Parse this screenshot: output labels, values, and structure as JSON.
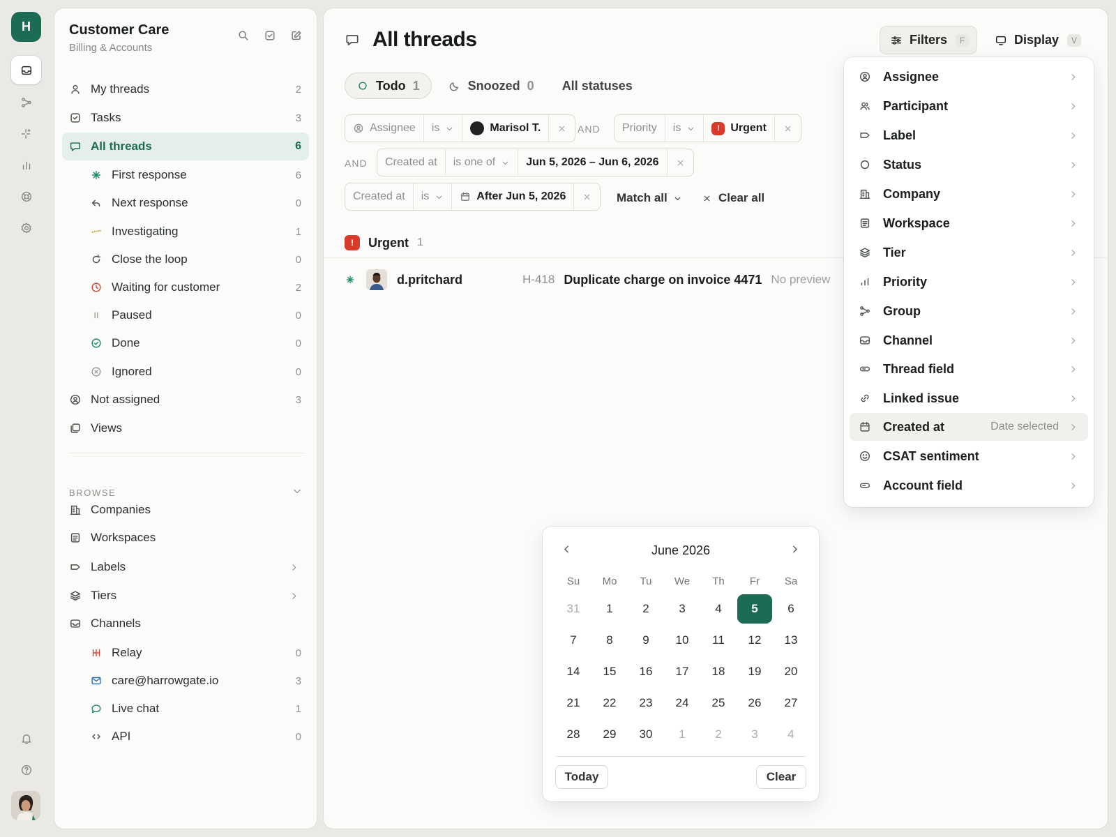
{
  "workspace": {
    "initial": "H"
  },
  "sidebar": {
    "title": "Customer Care",
    "subtitle": "Billing & Accounts",
    "items": [
      {
        "label": "My threads",
        "count": "2"
      },
      {
        "label": "Tasks",
        "count": "3"
      },
      {
        "label": "All threads",
        "count": "6"
      },
      {
        "label": "First response",
        "count": "6"
      },
      {
        "label": "Next response",
        "count": "0"
      },
      {
        "label": "Investigating",
        "count": "1"
      },
      {
        "label": "Close the loop",
        "count": "0"
      },
      {
        "label": "Waiting for customer",
        "count": "2"
      },
      {
        "label": "Paused",
        "count": "0"
      },
      {
        "label": "Done",
        "count": "0"
      },
      {
        "label": "Ignored",
        "count": "0"
      },
      {
        "label": "Not assigned",
        "count": "3"
      },
      {
        "label": "Views"
      }
    ],
    "browse_label": "BROWSE",
    "browse_items": [
      {
        "label": "Companies"
      },
      {
        "label": "Workspaces"
      },
      {
        "label": "Labels"
      },
      {
        "label": "Tiers"
      },
      {
        "label": "Channels"
      },
      {
        "label": "Relay",
        "count": "0"
      },
      {
        "label": "care@harrowgate.io",
        "count": "3"
      },
      {
        "label": "Live chat",
        "count": "1"
      },
      {
        "label": "API",
        "count": "0"
      }
    ]
  },
  "main": {
    "title": "All threads",
    "filters_btn": {
      "label": "Filters",
      "kbd": "F"
    },
    "display_btn": {
      "label": "Display",
      "kbd": "V"
    },
    "status_tabs": [
      {
        "label": "Todo",
        "count": "1"
      },
      {
        "label": "Snoozed",
        "count": "0"
      },
      {
        "label": "All statuses"
      }
    ],
    "filters": {
      "assignee": {
        "field": "Assignee",
        "op": "is",
        "value": "Marisol T."
      },
      "and1": "AND",
      "priority": {
        "field": "Priority",
        "op": "is",
        "value": "Urgent"
      },
      "and2": "AND",
      "created1": {
        "field": "Created at",
        "op": "is one of",
        "value": "Jun 5, 2026 – Jun 6, 2026"
      },
      "created2": {
        "field": "Created at",
        "op": "is",
        "value": "After Jun 5, 2026"
      },
      "match": "Match all",
      "clear": "Clear all"
    },
    "group": {
      "label": "Urgent",
      "count": "1",
      "badge": "!"
    },
    "threads": [
      {
        "user": "d.pritchard",
        "id": "H-418",
        "title": "Duplicate charge on invoice 4471",
        "preview": "No preview"
      }
    ]
  },
  "filter_menu": {
    "items": [
      {
        "label": "Assignee",
        "icon": "user-circle-icon"
      },
      {
        "label": "Participant",
        "icon": "users-icon"
      },
      {
        "label": "Label",
        "icon": "tag-icon"
      },
      {
        "label": "Status",
        "icon": "circle-icon"
      },
      {
        "label": "Company",
        "icon": "building-icon"
      },
      {
        "label": "Workspace",
        "icon": "document-icon"
      },
      {
        "label": "Tier",
        "icon": "layers-icon"
      },
      {
        "label": "Priority",
        "icon": "bars-icon"
      },
      {
        "label": "Group",
        "icon": "branch-icon"
      },
      {
        "label": "Channel",
        "icon": "inbox-icon"
      },
      {
        "label": "Thread field",
        "icon": "field-icon"
      },
      {
        "label": "Linked issue",
        "icon": "link-icon"
      },
      {
        "label": "Created at",
        "icon": "calendar-icon",
        "meta": "Date selected"
      },
      {
        "label": "CSAT sentiment",
        "icon": "smile-icon"
      },
      {
        "label": "Account field",
        "icon": "field-icon"
      }
    ]
  },
  "calendar": {
    "month": "June 2026",
    "weekdays": [
      "Su",
      "Mo",
      "Tu",
      "We",
      "Th",
      "Fr",
      "Sa"
    ],
    "weeks": [
      [
        "31",
        "1",
        "2",
        "3",
        "4",
        "5",
        "6"
      ],
      [
        "7",
        "8",
        "9",
        "10",
        "11",
        "12",
        "13"
      ],
      [
        "14",
        "15",
        "16",
        "17",
        "18",
        "19",
        "20"
      ],
      [
        "21",
        "22",
        "23",
        "24",
        "25",
        "26",
        "27"
      ],
      [
        "28",
        "29",
        "30",
        "1",
        "2",
        "3",
        "4"
      ]
    ],
    "selected": "5",
    "today_label": "Today",
    "clear_label": "Clear"
  },
  "colors": {
    "accent": "#1c6b55",
    "urgent": "#d83a2c"
  }
}
